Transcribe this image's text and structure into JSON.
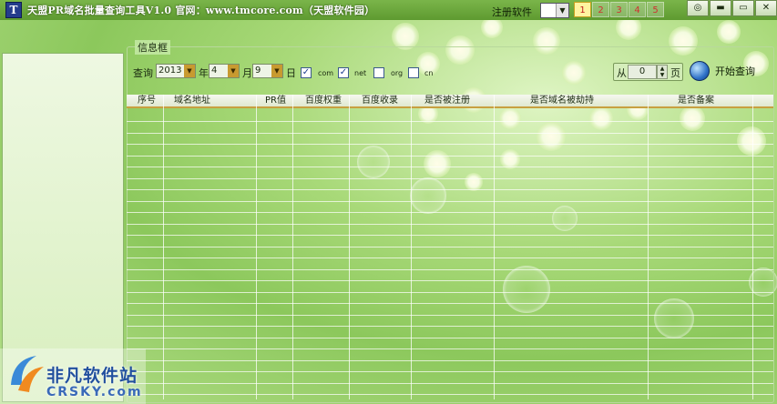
{
  "window": {
    "title": "天盟PR域名批量查询工具V1.0 官网：www.tmcore.com（天盟软件园）",
    "icon_glyph": "T"
  },
  "toolbar": {
    "register_label": "注册软件",
    "skins": [
      "1",
      "2",
      "3",
      "4",
      "5"
    ],
    "active_skin": "1",
    "buttons": [
      "feedback-icon",
      "settings-icon",
      "minimize-icon",
      "close-icon"
    ],
    "button_glyphs": [
      "◎",
      "▬",
      "▭",
      "✕"
    ]
  },
  "frame": {
    "legend": "信息框"
  },
  "query": {
    "label": "查询",
    "year": "2013",
    "year_unit": "年",
    "month": "4",
    "month_unit": "月",
    "day": "9",
    "day_unit": "日",
    "combo_arrow": "▼",
    "tlds": [
      {
        "label": "com",
        "checked": true
      },
      {
        "label": "net",
        "checked": true
      },
      {
        "label": "org",
        "checked": false
      },
      {
        "label": "cn",
        "checked": false
      }
    ],
    "check_mark": "✓",
    "from_label": "从",
    "page_value": "0",
    "page_unit": "页",
    "start_button": "开始查询"
  },
  "table": {
    "columns": [
      "序号",
      "域名地址",
      "PR值",
      "百度权重",
      "百度收录",
      "是否被注册",
      "是否域名被劫持",
      "是否备案"
    ],
    "rows": []
  },
  "watermark": {
    "line1": "非凡软件站",
    "line2": "CRSKY.com"
  },
  "colors": {
    "accent": "#c8a040",
    "title_bar": "#6aa83c",
    "background": "#a8d978"
  }
}
